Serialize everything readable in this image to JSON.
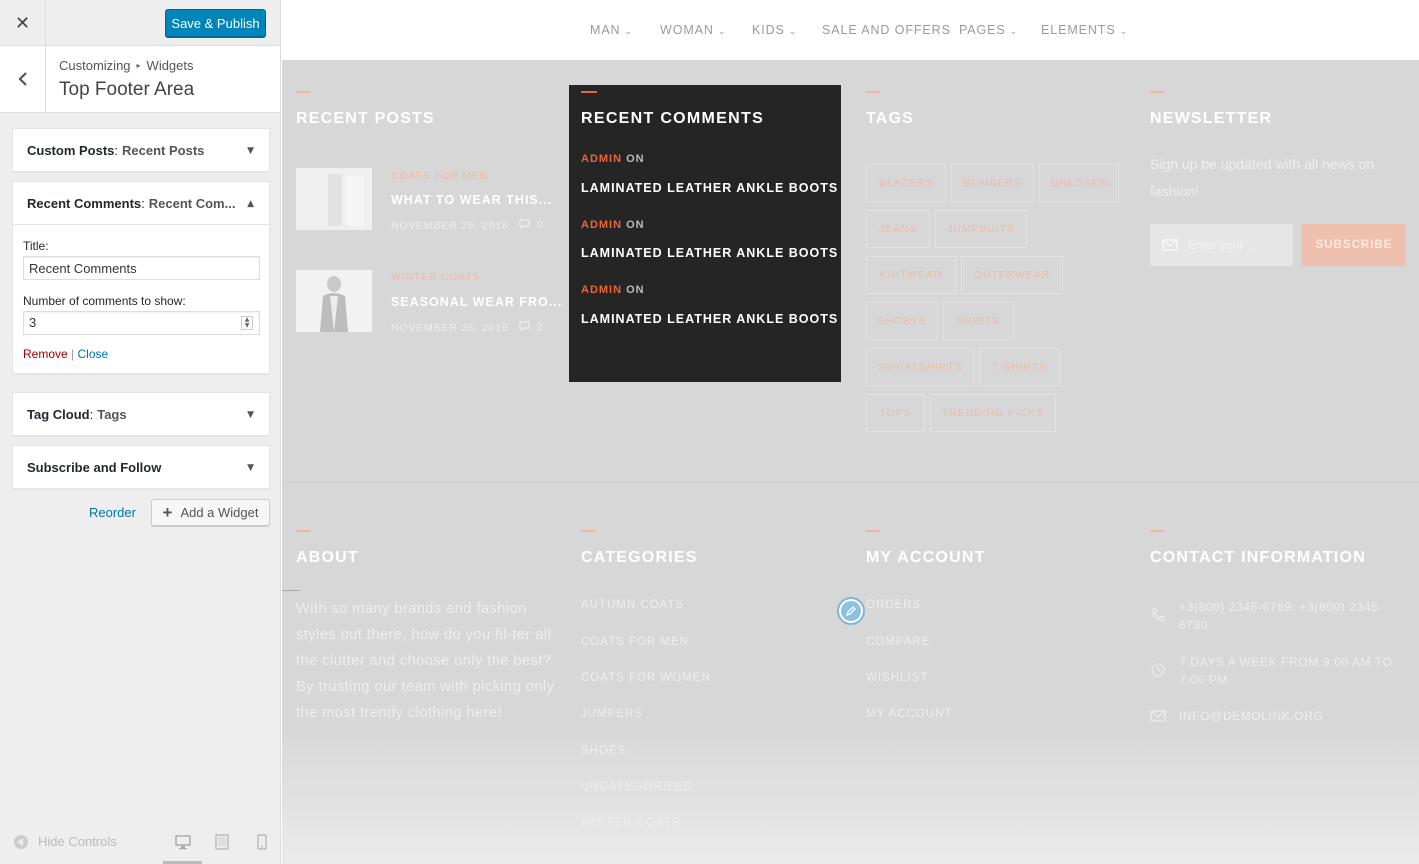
{
  "sidebar": {
    "close_glyph": "✕",
    "save_label": "Save & Publish",
    "breadcrumb": [
      "Customizing",
      "Widgets"
    ],
    "breadcrumb_sep": "▸",
    "section_title": "Top Footer Area",
    "widgets": [
      {
        "title": "Custom Posts",
        "subtitle": "Recent Posts",
        "expanded": false
      },
      {
        "title": "Recent Comments",
        "subtitle": "Recent Com...",
        "expanded": true
      },
      {
        "title": "Tag Cloud",
        "subtitle": "Tags",
        "expanded": false
      },
      {
        "title": "Subscribe and Follow",
        "subtitle": "",
        "expanded": false
      }
    ],
    "form": {
      "title_label": "Title:",
      "title_value": "Recent Comments",
      "count_label": "Number of comments to show:",
      "count_value": "3",
      "remove_label": "Remove",
      "sep": "|",
      "close_label": "Close"
    },
    "reorder_label": "Reorder",
    "add_widget_label": "Add a Widget",
    "hide_controls_label": "Hide Controls"
  },
  "nav": [
    {
      "label": "MAN",
      "dropdown": true
    },
    {
      "label": "WOMAN",
      "dropdown": true
    },
    {
      "label": "KIDS",
      "dropdown": true
    },
    {
      "label": "SALE AND OFFERS",
      "dropdown": false
    },
    {
      "label": "PAGES",
      "dropdown": true
    },
    {
      "label": "ELEMENTS",
      "dropdown": true
    }
  ],
  "recent_posts": {
    "title": "RECENT POSTS",
    "posts": [
      {
        "category": "COATS FOR MEN",
        "title": "WHAT TO WEAR THIS...",
        "date": "NOVEMBER 26, 2016",
        "comments": "0"
      },
      {
        "category": "WINTER COATS",
        "title": "SEASONAL WEAR FRO...",
        "date": "NOVEMBER 26, 2016",
        "comments": "2"
      }
    ]
  },
  "recent_comments": {
    "title": "RECENT COMMENTS",
    "items": [
      {
        "author": "ADMIN",
        "on": "ON",
        "post": "LAMINATED LEATHER ANKLE BOOTS"
      },
      {
        "author": "ADMIN",
        "on": "ON",
        "post": "LAMINATED LEATHER ANKLE BOOTS"
      },
      {
        "author": "ADMIN",
        "on": "ON",
        "post": "LAMINATED LEATHER ANKLE BOOTS"
      }
    ]
  },
  "tags": {
    "title": "TAGS",
    "items": [
      "BLAZERS",
      "BOMBERS",
      "DRESSES",
      "JEANS",
      "JUMPSUITS",
      "KNITWEAR",
      "OUTERWEAR",
      "SHORTS",
      "SKIRTS",
      "SWEATSHIRTS",
      "T-SHIRTS",
      "TOPS",
      "TRENDING PICKS"
    ]
  },
  "newsletter": {
    "title": "NEWSLETTER",
    "text": "Sign up be updated with all news on fashion!",
    "placeholder": "Enter your ...",
    "button": "SUBSCRIBE"
  },
  "about": {
    "title": "ABOUT",
    "text": "With so many brands and fashion styles out there, how do you fil-ter all the clutter and choose only the best? By trusting our team with picking only the most trendy clothing here!"
  },
  "categories": {
    "title": "CATEGORIES",
    "items": [
      "AUTUMN COATS",
      "COATS FOR MEN",
      "COATS FOR WOMEN",
      "JUMPERS",
      "SHOES",
      "UNCATEGORIZED",
      "WINTER COATS"
    ]
  },
  "my_account": {
    "title": "MY ACCOUNT",
    "items": [
      "ORDERS",
      "COMPARE",
      "WISHLIST",
      "MY ACCOUNT"
    ]
  },
  "contact": {
    "title": "CONTACT INFORMATION",
    "phone": "+3(800) 2345-6789; +3(800) 2345-6790",
    "hours": "7 DAYS A WEEK FROM 9:00 AM TO 7:00 PM",
    "email": "INFO@DEMOLINK.ORG"
  },
  "colors": {
    "accent": "#e8663a",
    "wp_blue": "#0085ba",
    "dark_widget": "#252525"
  }
}
